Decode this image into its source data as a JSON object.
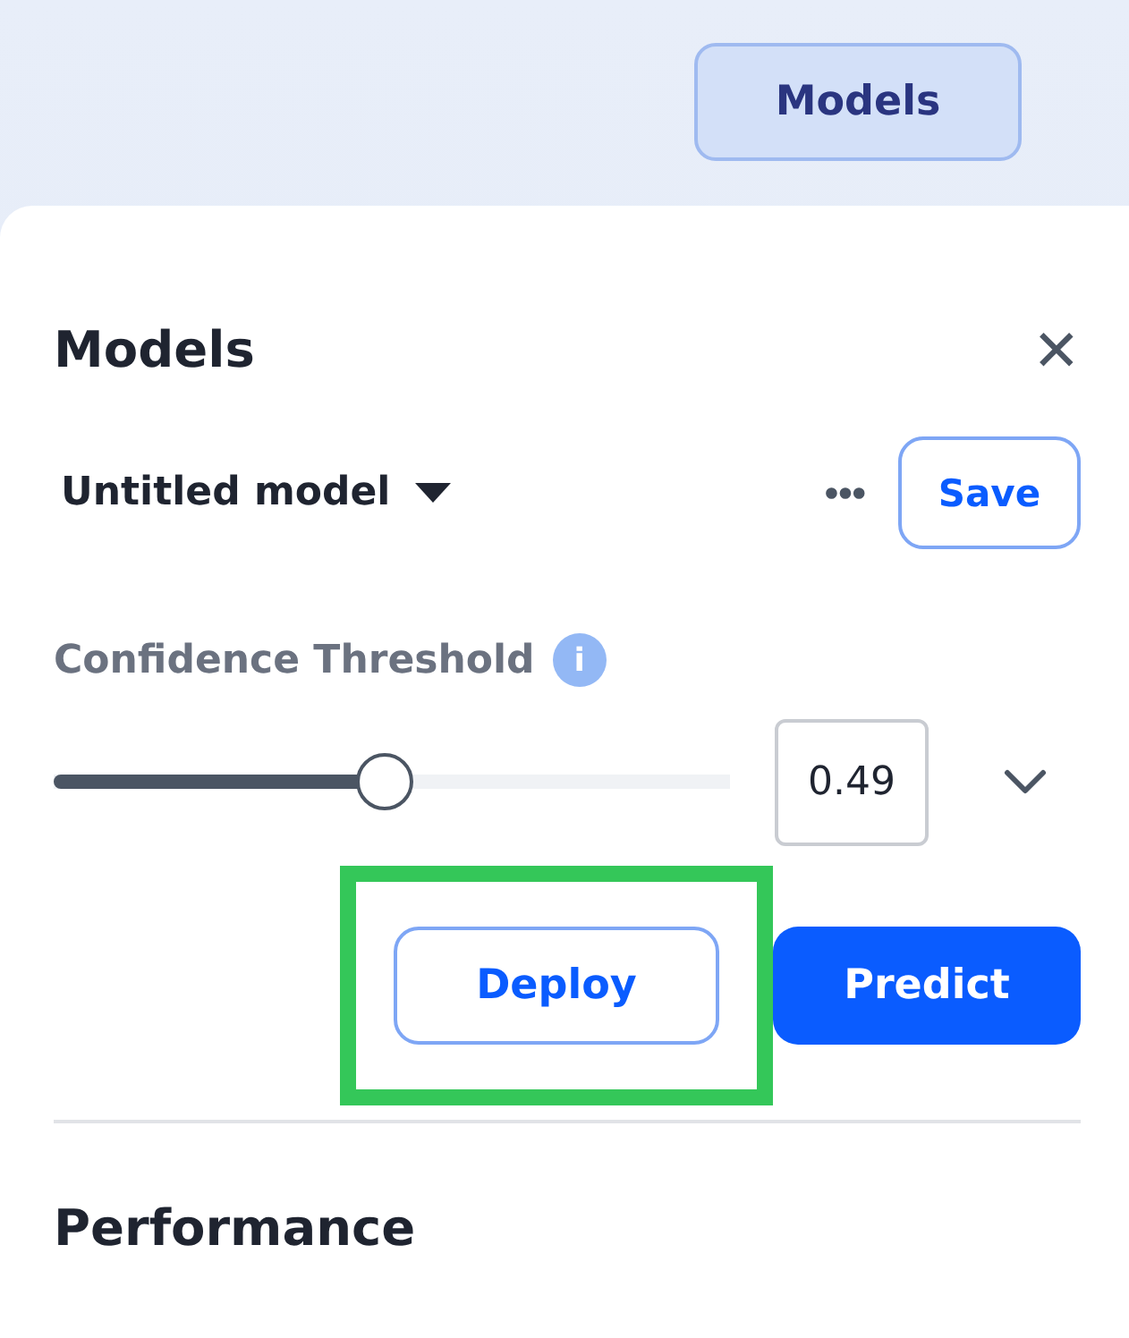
{
  "top_bar": {
    "button": "Models"
  },
  "panel": {
    "title": "Models",
    "close": "✕"
  },
  "model": {
    "name": "Untitled model",
    "more": "•••",
    "save": "Save"
  },
  "threshold": {
    "label": "Confidence Threshold",
    "info": "i",
    "level": 0.49,
    "value": "0.49"
  },
  "actions": [
    {
      "label": "Deploy",
      "kind": "outline",
      "highlighted": true
    },
    {
      "label": "Predict",
      "kind": "primary",
      "highlighted": false
    }
  ],
  "section": {
    "title": "Performance"
  }
}
